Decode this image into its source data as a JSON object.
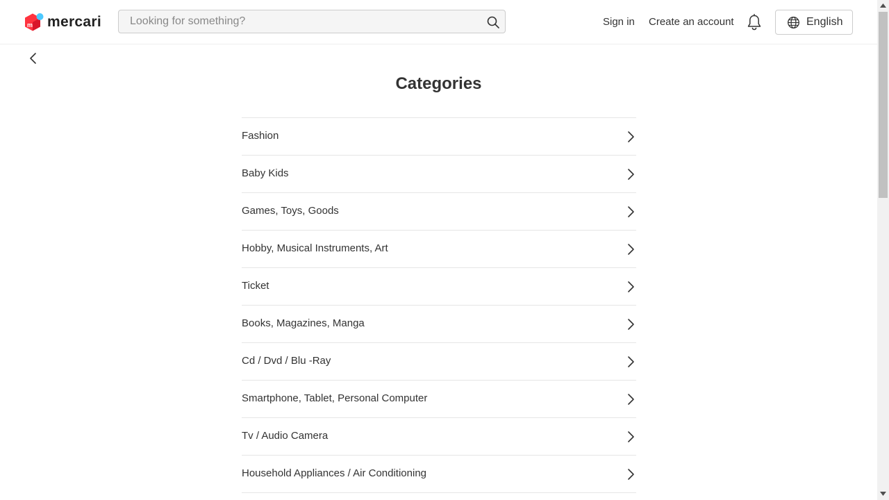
{
  "header": {
    "logo_text": "mercari",
    "search": {
      "placeholder": "Looking for something?",
      "value": ""
    },
    "sign_in_label": "Sign in",
    "create_account_label": "Create an account",
    "language_label": "English"
  },
  "page": {
    "title": "Categories",
    "categories": [
      {
        "label": "Fashion"
      },
      {
        "label": "Baby Kids"
      },
      {
        "label": "Games, Toys, Goods"
      },
      {
        "label": "Hobby, Musical Instruments, Art"
      },
      {
        "label": "Ticket"
      },
      {
        "label": "Books, Magazines, Manga"
      },
      {
        "label": "Cd / Dvd / Blu -Ray"
      },
      {
        "label": "Smartphone, Tablet, Personal Computer"
      },
      {
        "label": "Tv / Audio Camera"
      },
      {
        "label": "Household Appliances / Air Conditioning"
      }
    ]
  },
  "icons": {
    "logo": "mercari-logo-icon",
    "search": "search-icon",
    "notifications": "bell-icon",
    "language": "globe-icon",
    "back": "chevron-left-icon",
    "row_arrow": "chevron-right-icon"
  },
  "colors": {
    "brand_red": "#ff333f",
    "brand_blue": "#4dc9ff",
    "text": "#333333",
    "border": "#e5e5e5",
    "search_bg": "#f5f5f5"
  }
}
